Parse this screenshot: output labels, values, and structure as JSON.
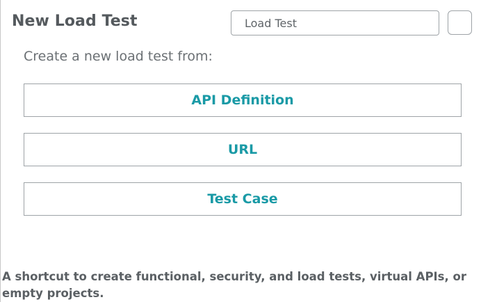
{
  "header": {
    "title": "New Load Test",
    "name_input_value": "Load Test"
  },
  "main": {
    "subtitle": "Create a new load test from:",
    "options": [
      {
        "label": "API Definition"
      },
      {
        "label": "URL"
      },
      {
        "label": "Test Case"
      }
    ]
  },
  "footer": {
    "description": "A shortcut to create functional, security, and load tests, virtual APIs, or empty projects."
  },
  "colors": {
    "accent": "#1a9aa6",
    "border": "#9ea3a7",
    "title_text": "#555a5e"
  }
}
